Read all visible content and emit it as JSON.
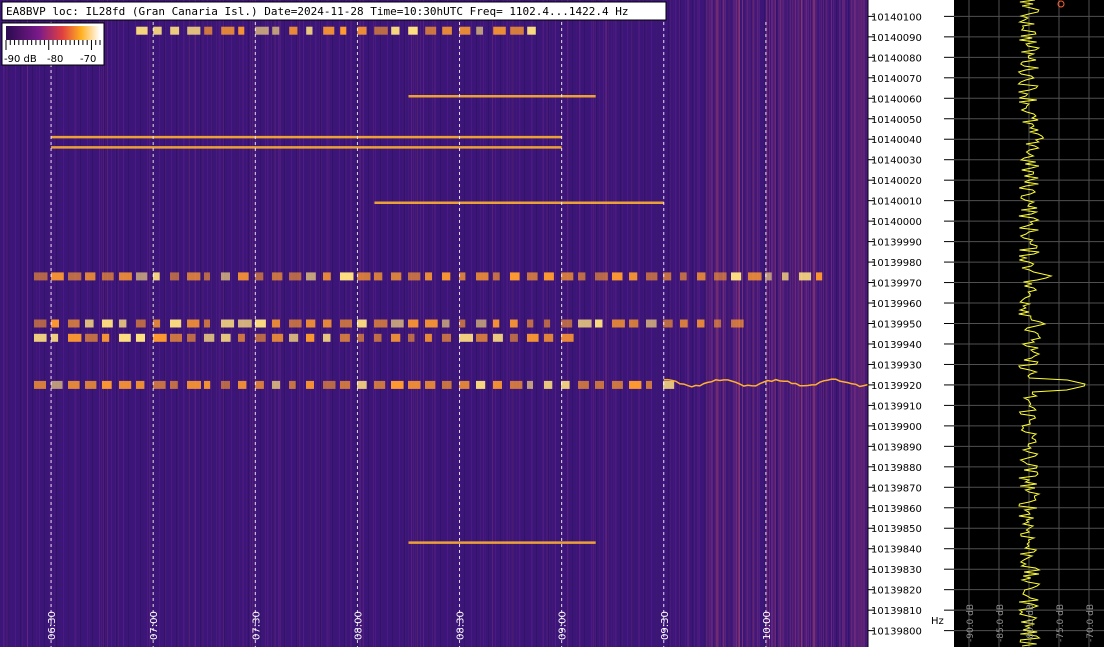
{
  "header": {
    "title": "EA8BVP loc: IL28fd (Gran Canaria Isl.) Date=2024-11-28 Time=10:30hUTC Freq= 1102.4...1422.4 Hz"
  },
  "colors": {
    "background": "#3a1478",
    "low": "#3a1478",
    "mid": "#d0305a",
    "high": "#ffe080",
    "peak": "#ffffff",
    "spectrum_trace": "#ffff30",
    "spectrum_bg": "#000000",
    "grid": "#ffffff"
  },
  "colorbar": {
    "labels": [
      "-90 dB",
      "-80",
      "-70"
    ]
  },
  "chart_data": [
    {
      "type": "heatmap",
      "title": "EA8BVP loc: IL28fd (Gran Canaria Isl.) Date=2024-11-28 Time=10:30hUTC Freq= 1102.4...1422.4 Hz",
      "xlabel": "",
      "ylabel": "Hz",
      "x_ticks": [
        "06:30",
        "07:00",
        "07:30",
        "08:00",
        "08:30",
        "09:00",
        "09:30",
        "10:00"
      ],
      "y_ticks": [
        "10140100",
        "10140090",
        "10140080",
        "10140070",
        "10140060",
        "10140050",
        "10140040",
        "10140030",
        "10140020",
        "10140010",
        "10140000",
        "10139990",
        "10139980",
        "10139970",
        "10139960",
        "10139950",
        "10139940",
        "10139930",
        "10139920",
        "10139910",
        "10139900",
        "10139890",
        "10139880",
        "10139870",
        "10139860",
        "10139850",
        "10139840",
        "10139830",
        "10139820",
        "10139810",
        "10139800"
      ],
      "y_unit": "Hz",
      "y_range": [
        10139792,
        10140108
      ],
      "x_range_hours": [
        6.25,
        10.5
      ],
      "colorbar_range_db": [
        -90,
        -68
      ],
      "grid": true,
      "signals": [
        {
          "freq": 10140041,
          "start": "06:30",
          "end": "09:00",
          "pattern": "continuous"
        },
        {
          "freq": 10140036,
          "start": "06:30",
          "end": "09:00",
          "pattern": "continuous"
        },
        {
          "freq": 10139973,
          "start": "06:25",
          "end": "10:15",
          "pattern": "keyed"
        },
        {
          "freq": 10139950,
          "start": "06:25",
          "end": "09:50",
          "pattern": "keyed"
        },
        {
          "freq": 10139943,
          "start": "06:25",
          "end": "09:00",
          "pattern": "keyed"
        },
        {
          "freq": 10139920,
          "start": "06:25",
          "end": "09:30",
          "pattern": "keyed"
        },
        {
          "freq": 10139921,
          "start": "09:30",
          "end": "10:30",
          "pattern": "wavy"
        },
        {
          "freq": 10140009,
          "start": "08:05",
          "end": "09:30",
          "pattern": "continuous"
        },
        {
          "freq": 10140061,
          "start": "08:15",
          "end": "09:10",
          "pattern": "continuous"
        },
        {
          "freq": 10139843,
          "start": "08:15",
          "end": "09:10",
          "pattern": "continuous"
        },
        {
          "freq": 10140093,
          "start": "06:55",
          "end": "08:50",
          "pattern": "keyed"
        }
      ]
    },
    {
      "type": "line",
      "title": "",
      "xlabel": "dB",
      "ylabel": "",
      "x_ticks": [
        "-90.0 dB",
        "-85.0 dB",
        "-80.0 dB",
        "-75.0 dB",
        "-70.0 dB"
      ],
      "x_range": [
        -92.5,
        -67.5
      ],
      "grid": true,
      "peaks": [
        {
          "freq": 10140041,
          "db": -77
        },
        {
          "freq": 10140036,
          "db": -78
        },
        {
          "freq": 10139973,
          "db": -76
        },
        {
          "freq": 10139950,
          "db": -77
        },
        {
          "freq": 10139943,
          "db": -78
        },
        {
          "freq": 10139920,
          "db": -70
        },
        {
          "freq": 10140009,
          "db": -79
        }
      ],
      "noise_floor_db": -80
    }
  ]
}
